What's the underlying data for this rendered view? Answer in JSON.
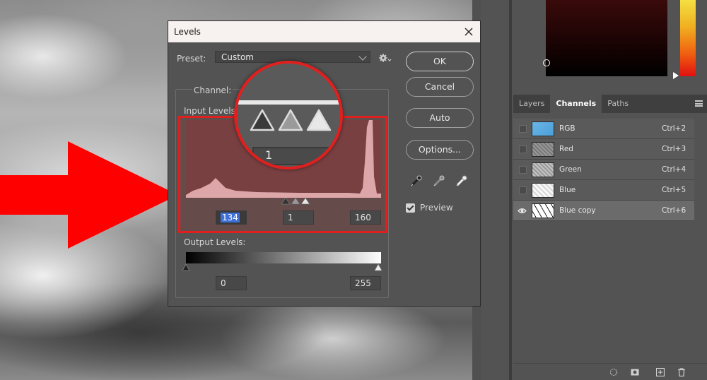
{
  "dialog": {
    "title": "Levels",
    "preset_label": "Preset:",
    "preset_value": "Custom",
    "channel_label": "Channel:",
    "input_levels_label": "Input Levels:",
    "output_levels_label": "Output Levels:",
    "input_black": "134",
    "input_gamma": "1",
    "input_white": "160",
    "output_black": "0",
    "output_white": "255",
    "magnified_value": "1",
    "buttons": {
      "ok": "OK",
      "cancel": "Cancel",
      "auto": "Auto",
      "options": "Options..."
    },
    "preview_label": "Preview",
    "preview_checked": true
  },
  "panels": {
    "tabs": [
      "Layers",
      "Channels",
      "Paths"
    ],
    "active_tab": "Channels",
    "channels": [
      {
        "name": "RGB",
        "shortcut": "Ctrl+2",
        "visible": false,
        "selected": false
      },
      {
        "name": "Red",
        "shortcut": "Ctrl+3",
        "visible": false,
        "selected": false
      },
      {
        "name": "Green",
        "shortcut": "Ctrl+4",
        "visible": false,
        "selected": false
      },
      {
        "name": "Blue",
        "shortcut": "Ctrl+5",
        "visible": false,
        "selected": false
      },
      {
        "name": "Blue copy",
        "shortcut": "Ctrl+6",
        "visible": true,
        "selected": true
      }
    ]
  },
  "colors": {
    "highlight_red": "#e0201f",
    "dialog_bg": "#535353",
    "titlebar_bg": "#f7f1ef",
    "selection_blue": "#3d6fd7"
  }
}
